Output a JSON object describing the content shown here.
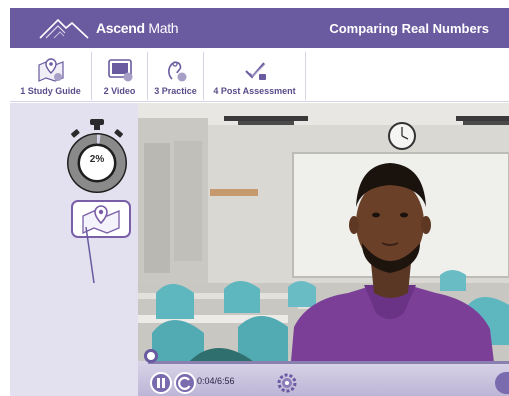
{
  "header": {
    "brand_bold": "Ascend",
    "brand_thin": " Math",
    "lesson_title": "Comparing Real Numbers"
  },
  "tabs": [
    {
      "label": "1 Study Guide",
      "icon": "map-pin-icon"
    },
    {
      "label": "2 Video",
      "icon": "video-screen-icon"
    },
    {
      "label": "3 Practice",
      "icon": "practice-hand-icon"
    },
    {
      "label": "4 Post Assessment",
      "icon": "check-pencil-icon"
    }
  ],
  "sidebar": {
    "timer_percent": "2%",
    "timer_progress": 0.02
  },
  "player": {
    "time": "0:04/6:56",
    "progress": 0.0096
  },
  "colors": {
    "brand_purple": "#6a5aa0",
    "sidebar_lavender": "#e3e0ef",
    "accent_violet": "#7a5fa8"
  }
}
